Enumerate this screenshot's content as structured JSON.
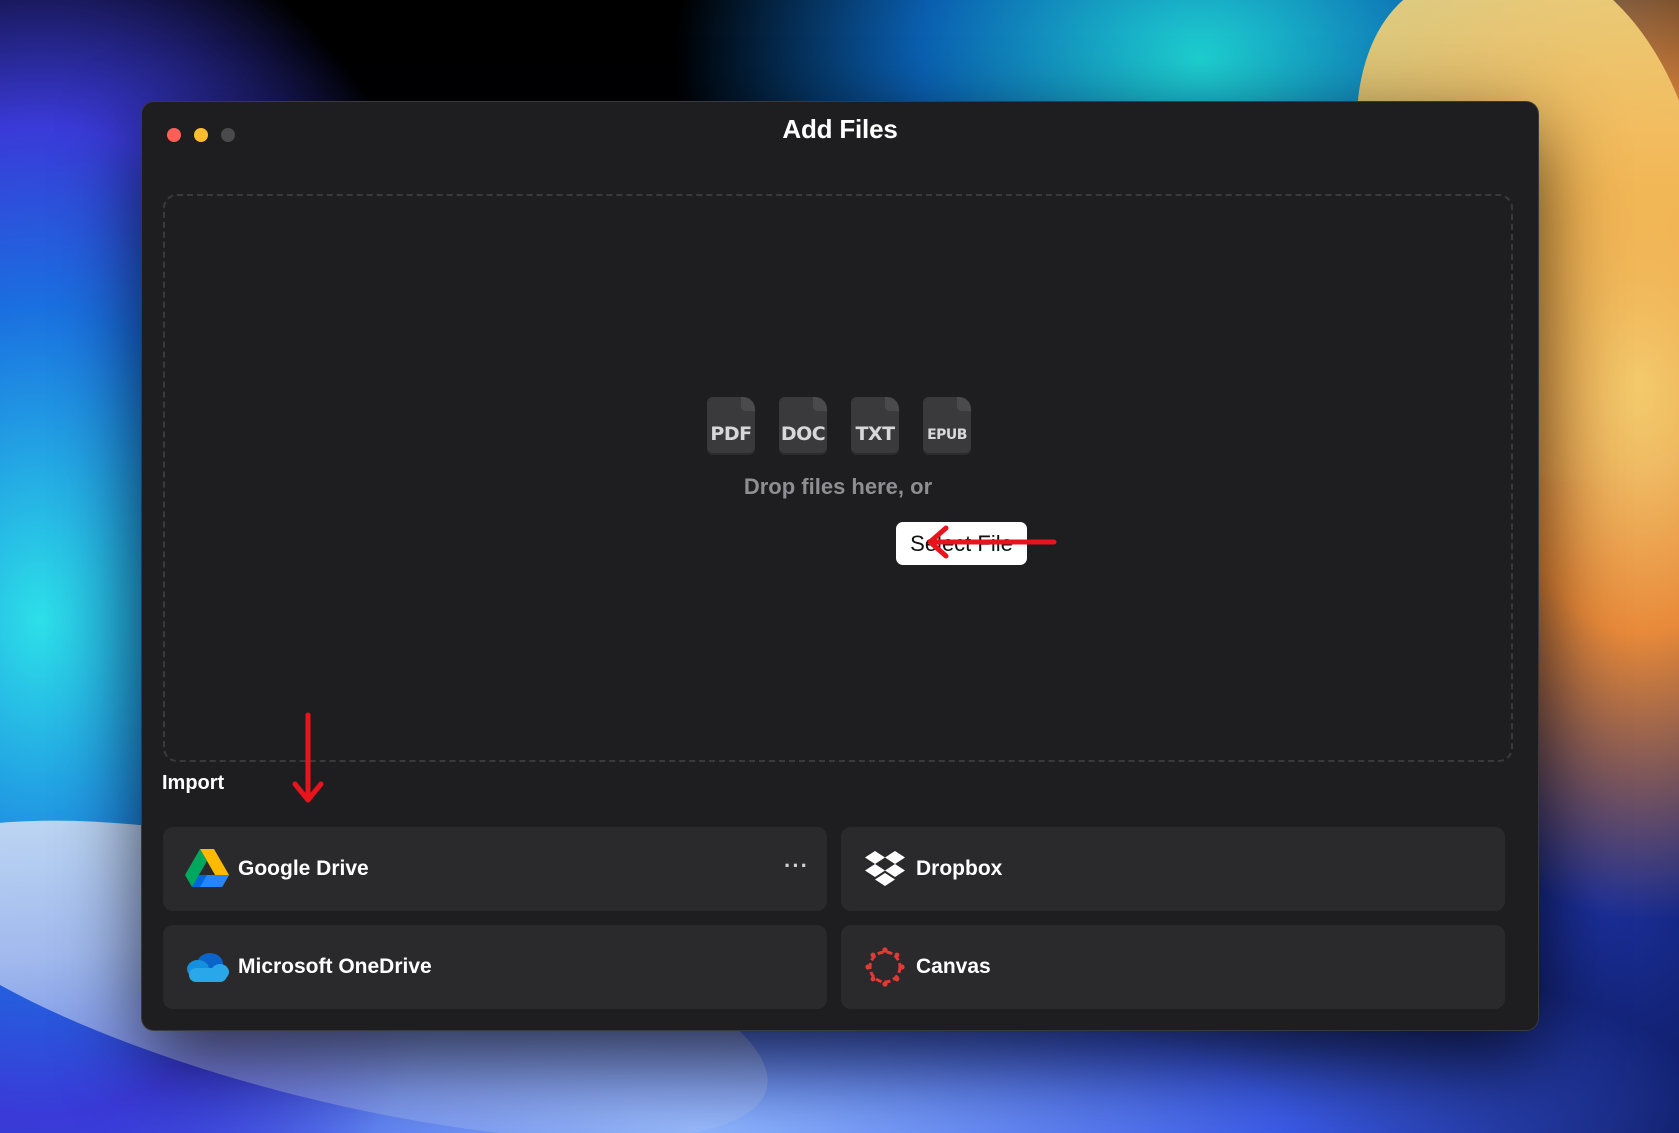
{
  "window": {
    "title": "Add Files"
  },
  "dropzone": {
    "file_types": [
      "PDF",
      "DOC",
      "TXT",
      "EPUB"
    ],
    "drop_text": "Drop files here, or",
    "select_button_label": "Select File"
  },
  "import": {
    "label": "Import",
    "sources": [
      {
        "label": "Google Drive",
        "icon": "google-drive-icon",
        "has_more": true,
        "more_label": "···"
      },
      {
        "label": "Dropbox",
        "icon": "dropbox-icon"
      },
      {
        "label": "Microsoft OneDrive",
        "icon": "onedrive-icon"
      },
      {
        "label": "Canvas",
        "icon": "canvas-icon"
      }
    ]
  },
  "colors": {
    "window_bg": "#1e1e20",
    "card_bg": "#2a2a2c",
    "annotation_arrow": "#e8141b",
    "canvas_red": "#e13b35"
  }
}
